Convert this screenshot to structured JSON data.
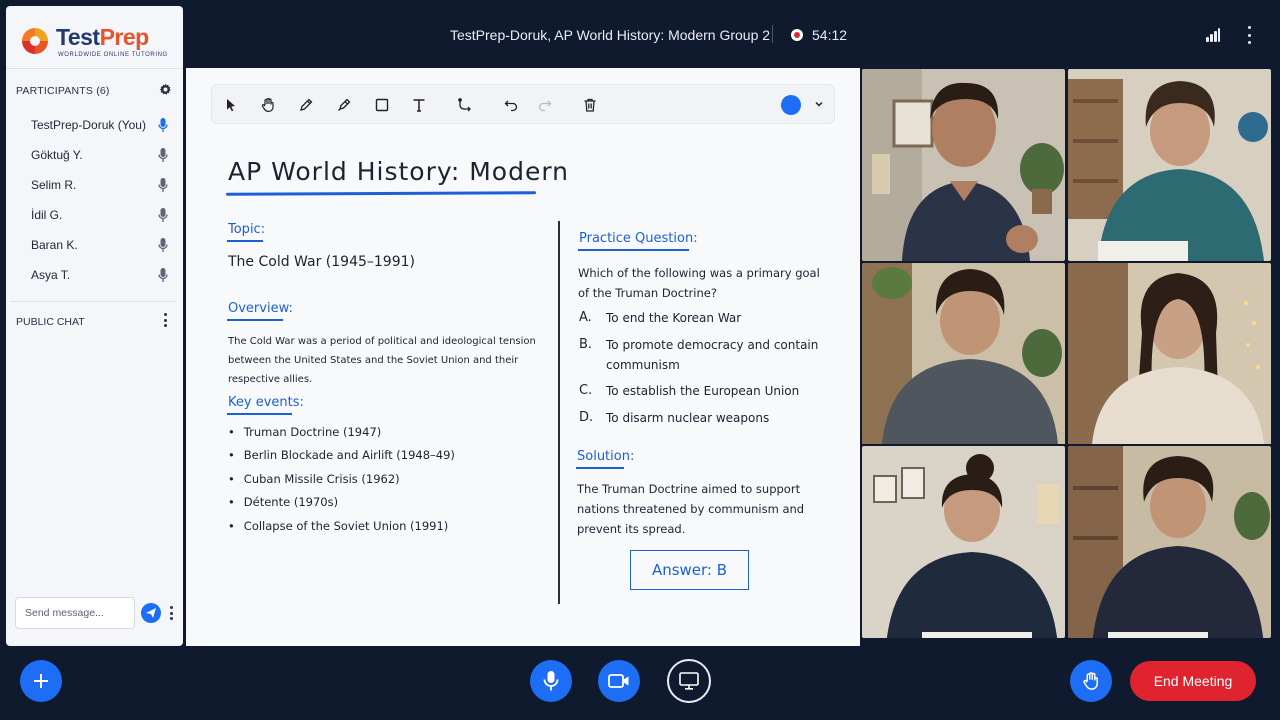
{
  "header": {
    "meeting_title": "TestPrep-Doruk, AP World History: Modern Group 2",
    "recording_time": "54:12"
  },
  "brand": {
    "name_primary": "Test",
    "name_accent": "Prep",
    "tagline": "WORLDWIDE ONLINE TUTORING"
  },
  "participants": {
    "header": "PARTICIPANTS (6)",
    "items": [
      {
        "name": "TestPrep-Doruk (You)",
        "mic": "active"
      },
      {
        "name": "Göktuğ Y.",
        "mic": "idle"
      },
      {
        "name": "Selim R.",
        "mic": "idle"
      },
      {
        "name": "İdil G.",
        "mic": "idle"
      },
      {
        "name": "Baran K.",
        "mic": "idle"
      },
      {
        "name": "Asya T.",
        "mic": "idle"
      }
    ]
  },
  "chat": {
    "header": "PUBLIC CHAT",
    "placeholder": "Send message..."
  },
  "toolbar": {
    "tools": [
      "select-icon",
      "pan-hand-icon",
      "pencil-icon",
      "highlighter-icon",
      "rectangle-icon",
      "text-icon",
      "connector-icon",
      "undo-icon",
      "redo-icon",
      "trash-icon"
    ],
    "selected_color": "#1d6ef5"
  },
  "board": {
    "title": "AP World History: Modern",
    "topic_label": "Topic:",
    "topic": "The Cold War (1945–1991)",
    "overview_label": "Overview:",
    "overview": "The Cold War was a period of political and ideological tension between the United States and the Soviet Union and their respective allies.",
    "key_events_label": "Key events:",
    "key_events": [
      "Truman Doctrine (1947)",
      "Berlin Blockade and Airlift (1948–49)",
      "Cuban Missile Crisis (1962)",
      "Détente (1970s)",
      "Collapse of the Soviet Union (1991)"
    ],
    "practice_label": "Practice Question:",
    "question": "Which of the following was a primary goal of the Truman Doctrine?",
    "options": [
      {
        "letter": "A.",
        "text": "To end the Korean War"
      },
      {
        "letter": "B.",
        "text": "To promote democracy and contain communism"
      },
      {
        "letter": "C.",
        "text": "To establish the European Union"
      },
      {
        "letter": "D.",
        "text": "To disarm nuclear weapons"
      }
    ],
    "solution_label": "Solution:",
    "solution": "The Truman Doctrine aimed to support nations threatened by communism and prevent its spread.",
    "answer": "Answer: B"
  },
  "controls": {
    "end_meeting": "End Meeting"
  },
  "colors": {
    "accent": "#1d6ef5",
    "ink_blue": "#1d5fd6",
    "end_red": "#e0242f",
    "background": "#0f1a2e"
  }
}
